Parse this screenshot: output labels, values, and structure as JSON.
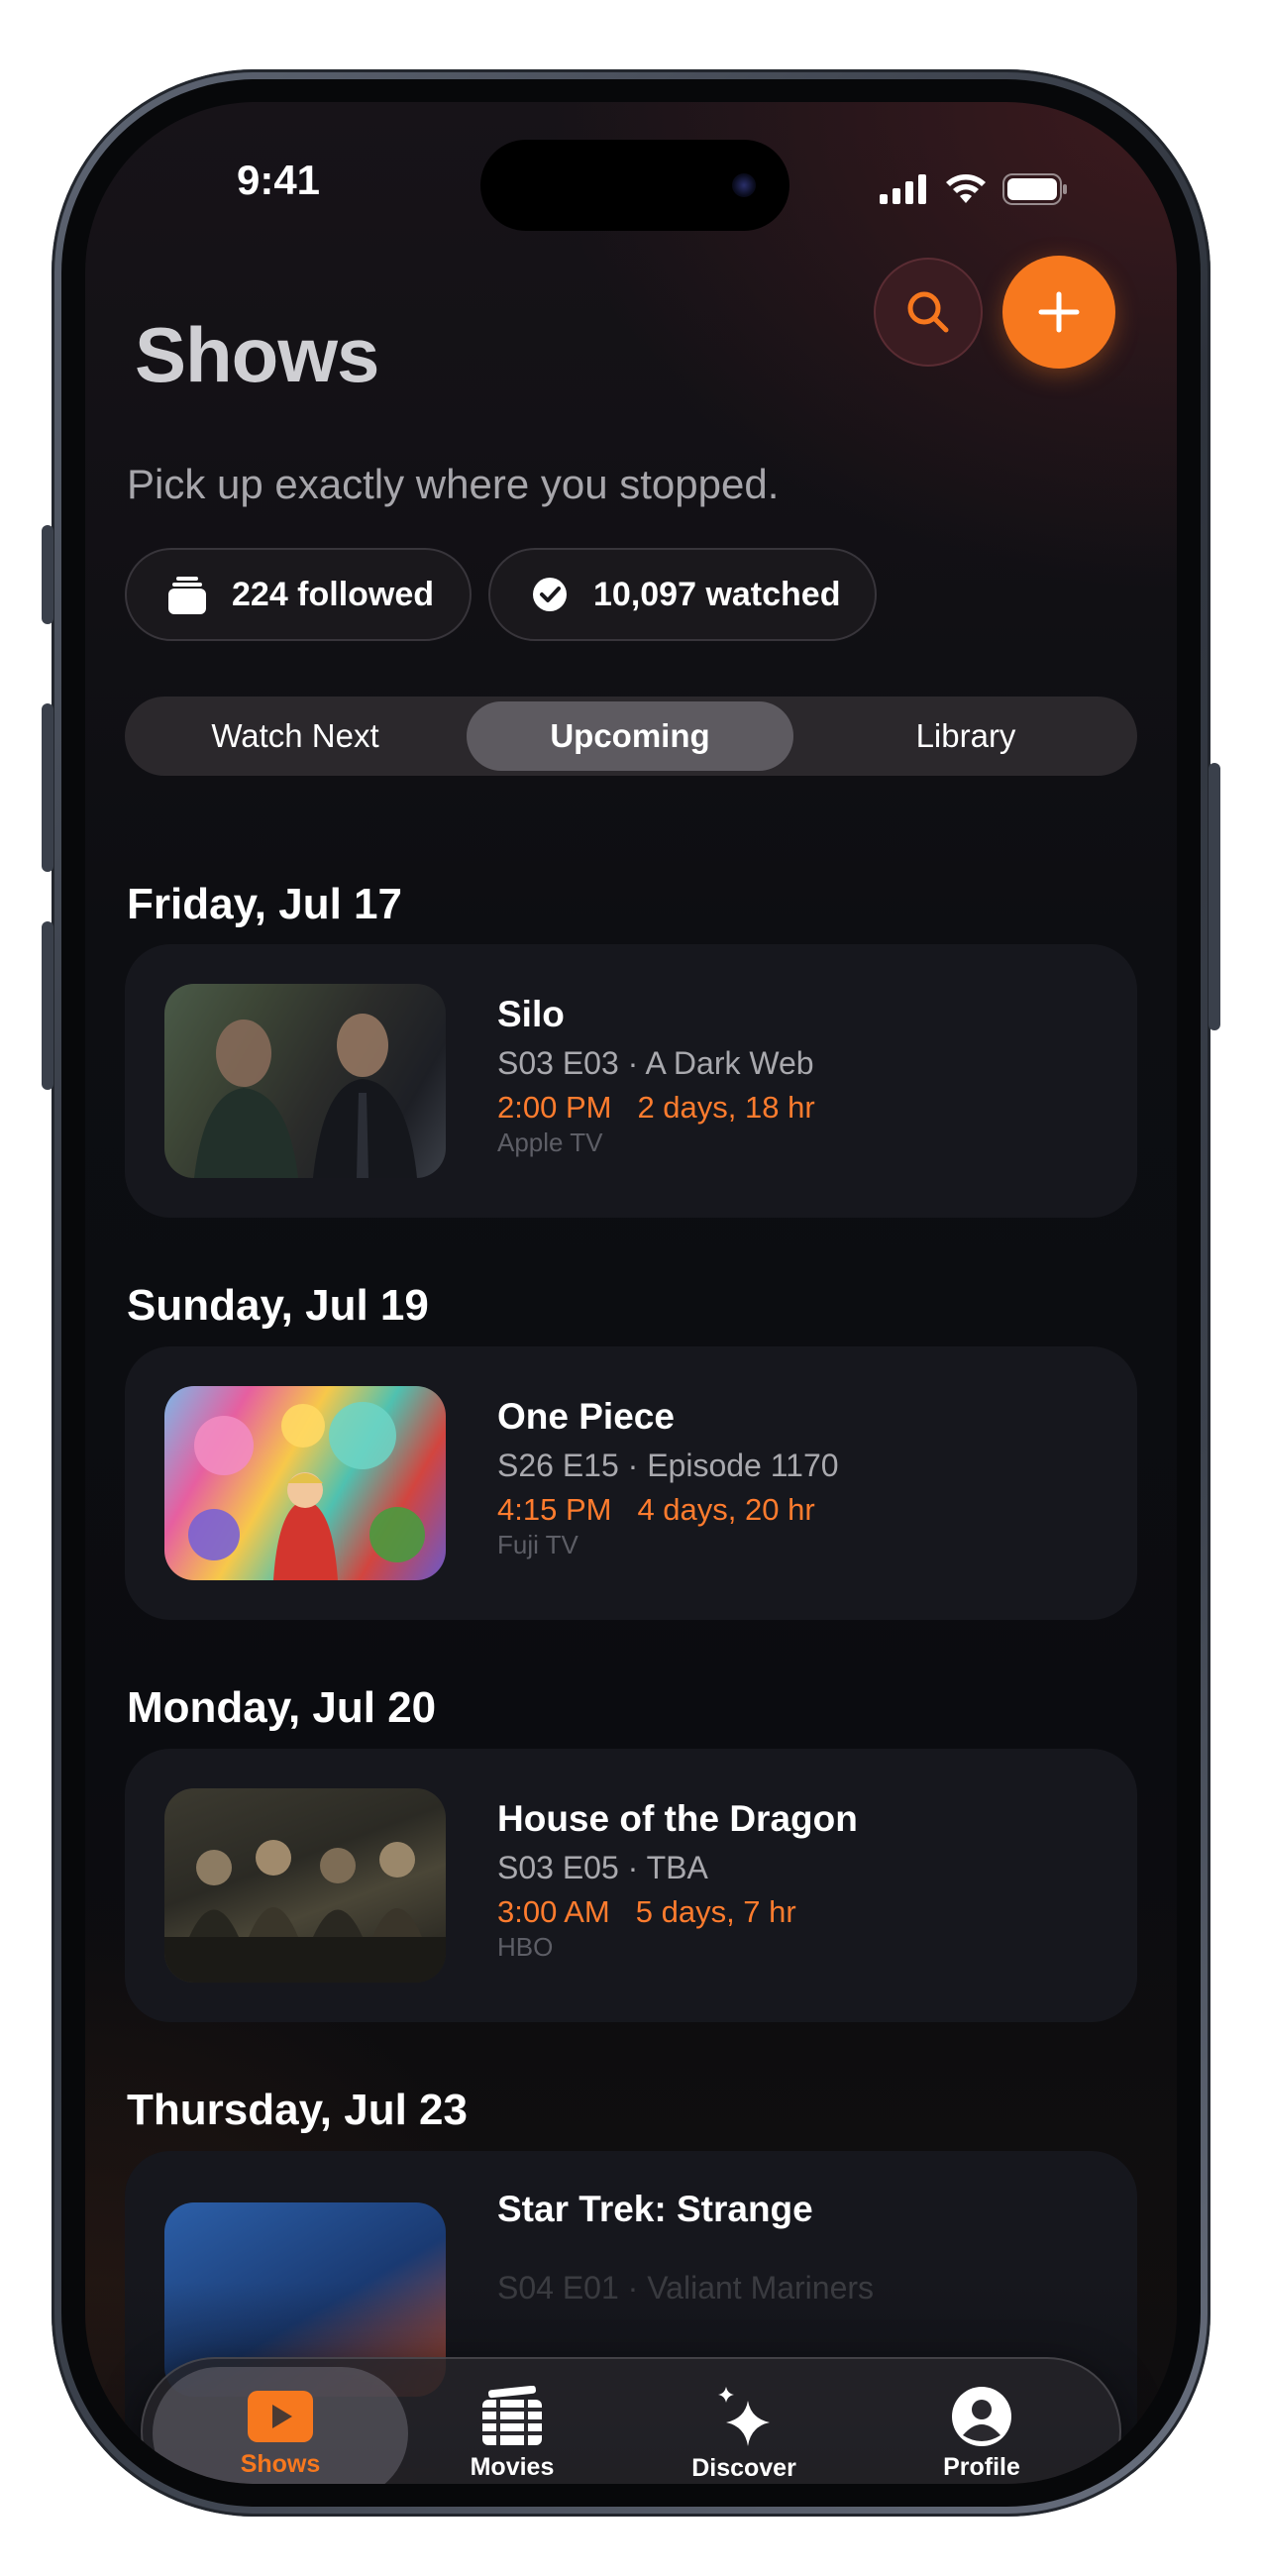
{
  "status_bar": {
    "time": "9:41"
  },
  "header": {
    "title": "Shows",
    "subtitle": "Pick up exactly where you stopped.",
    "search_icon": "search-icon",
    "add_icon": "plus-icon"
  },
  "stats": {
    "followed": "224 followed",
    "watched": "10,097 watched"
  },
  "segments": {
    "items": [
      "Watch Next",
      "Upcoming",
      "Library"
    ],
    "selected": "Upcoming"
  },
  "sections": [
    {
      "date": "Friday, Jul 17",
      "show": {
        "title": "Silo",
        "episode": "S03 E03 · A Dark Web",
        "time": "2:00 PM",
        "countdown": "2 days, 18 hr",
        "network": "Apple TV"
      }
    },
    {
      "date": "Sunday, Jul 19",
      "show": {
        "title": "One Piece",
        "episode": "S26 E15 · Episode 1170",
        "time": "4:15 PM",
        "countdown": "4 days, 20 hr",
        "network": "Fuji TV"
      }
    },
    {
      "date": "Monday, Jul 20",
      "show": {
        "title": "House of the Dragon",
        "episode": "S03 E05 · TBA",
        "time": "3:00 AM",
        "countdown": "5 days, 7 hr",
        "network": "HBO"
      }
    },
    {
      "date": "Thursday, Jul 23",
      "show": {
        "title": "Star Trek: Strange",
        "episode": "S04 E01 · Valiant Mariners",
        "time": "",
        "countdown": "",
        "network": ""
      }
    }
  ],
  "tabbar": {
    "items": [
      {
        "label": "Shows",
        "icon": "play-icon"
      },
      {
        "label": "Movies",
        "icon": "film-icon"
      },
      {
        "label": "Discover",
        "icon": "sparkles-icon"
      },
      {
        "label": "Profile",
        "icon": "person-icon"
      }
    ],
    "selected": "Shows"
  },
  "colors": {
    "accent": "#f7781e",
    "airtime": "#ff7c2e",
    "card": "#16171d"
  }
}
